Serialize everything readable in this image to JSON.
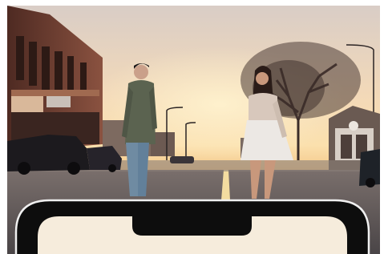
{
  "scene": {
    "description_tag": "",
    "storefront_sign": "",
    "colors": {
      "sky_top": "#e9d6c8",
      "sky_bottom": "#f6d6a8",
      "road": "#5a5658",
      "phone_frame": "#0d0d0d",
      "phone_screen": "#f6ecdc",
      "building_brick": "#6b3b2e",
      "tree": "#3a2c28"
    },
    "icons": [
      "phone-frame-icon",
      "notch-icon"
    ]
  }
}
